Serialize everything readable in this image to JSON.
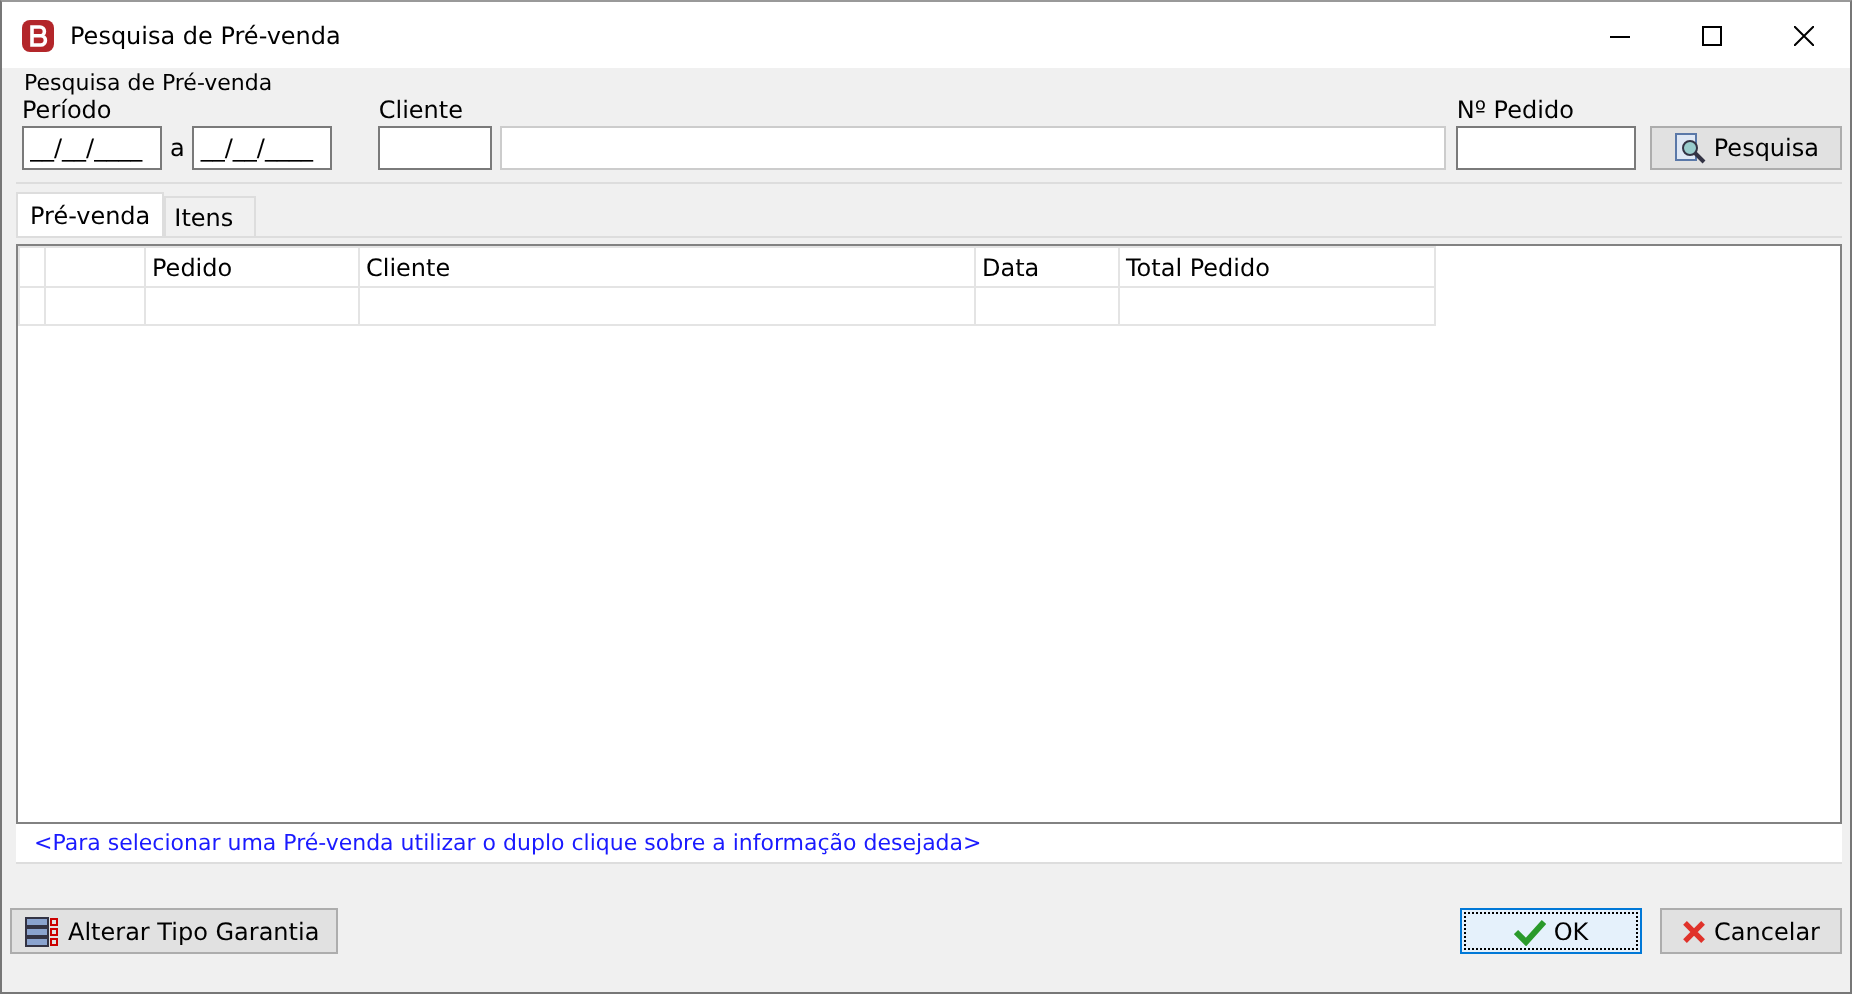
{
  "window": {
    "title": "Pesquisa de Pré-venda"
  },
  "search_group": {
    "title": "Pesquisa de Pré-venda",
    "period_label": "Período",
    "date_from": "__/__/____",
    "separator": "a",
    "date_to": "__/__/____",
    "client_label": "Cliente",
    "order_label": "Nº Pedido",
    "search_button": "Pesquisa"
  },
  "tabs": [
    {
      "label": "Pré-venda",
      "selected": true
    },
    {
      "label": "Itens",
      "selected": false
    }
  ],
  "table": {
    "columns": [
      "Pedido",
      "Cliente",
      "Data",
      "Total Pedido"
    ]
  },
  "hint": "<Para selecionar uma Pré-venda utilizar o duplo clique sobre a informação desejada>",
  "buttons": {
    "alter": "Alterar Tipo Garantia",
    "ok": "OK",
    "cancel": "Cancelar"
  }
}
